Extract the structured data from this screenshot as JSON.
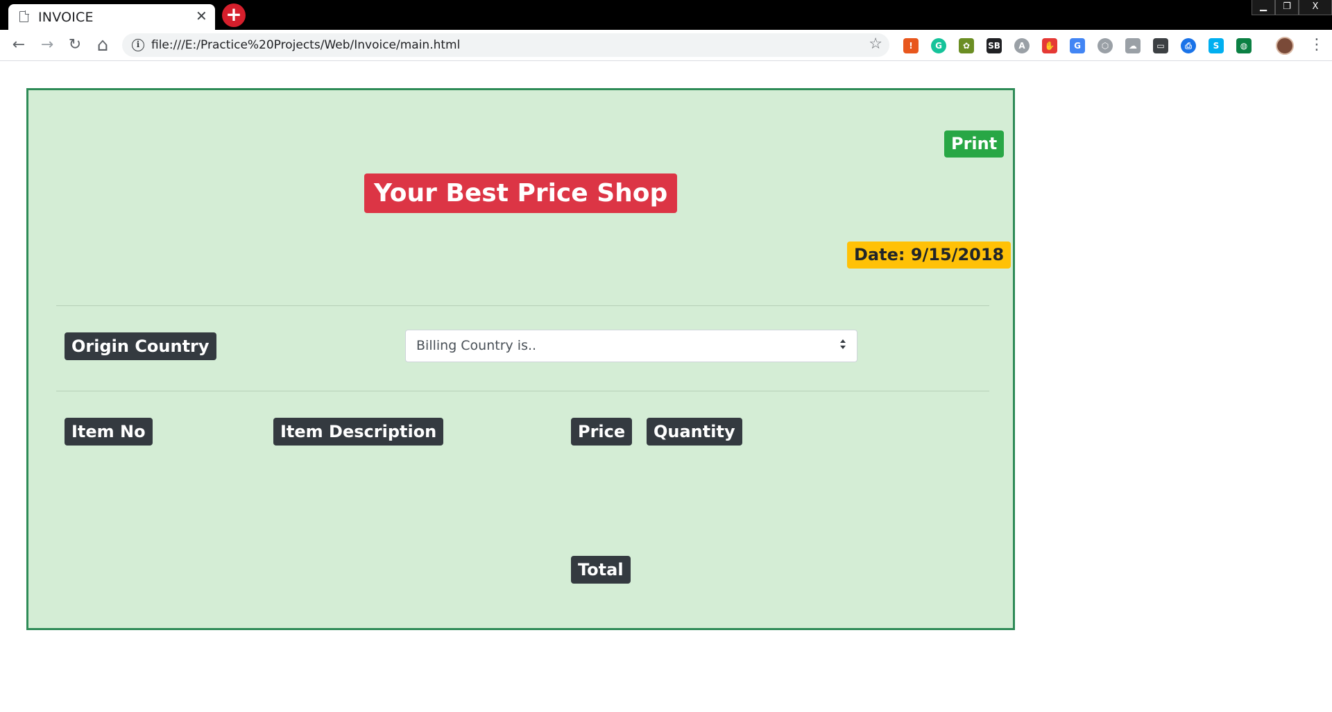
{
  "browser": {
    "tab_title": "INVOICE",
    "tab_close": "✕",
    "new_tab": "+",
    "url": "file:///E:/Practice%20Projects/Web/Invoice/main.html",
    "window_controls": {
      "minimize": "▁",
      "restore": "❐",
      "close": "X"
    },
    "nav": {
      "back": "←",
      "forward": "→",
      "reload": "↻",
      "home": "⌂",
      "info": "i",
      "bookmark": "☆",
      "menu": "⋮"
    },
    "extensions": [
      {
        "name": "alert-extension-icon",
        "glyph": "!",
        "color": "#e8571d"
      },
      {
        "name": "grammarly-extension-icon",
        "glyph": "G",
        "color": "#15c39a"
      },
      {
        "name": "plant-extension-icon",
        "glyph": "✿",
        "color": "#6b8e23"
      },
      {
        "name": "sb-extension-icon",
        "glyph": "SB",
        "color": "#202124"
      },
      {
        "name": "translate-lite-extension-icon",
        "glyph": "A",
        "color": "#9aa0a6"
      },
      {
        "name": "stop-extension-icon",
        "glyph": "✋",
        "color": "#e53935"
      },
      {
        "name": "google-translate-extension-icon",
        "glyph": "G",
        "color": "#4285f4"
      },
      {
        "name": "cube-extension-icon",
        "glyph": "⬡",
        "color": "#9aa0a6"
      },
      {
        "name": "cloud-extension-icon",
        "glyph": "☁",
        "color": "#9aa0a6"
      },
      {
        "name": "cast-extension-icon",
        "glyph": "▭",
        "color": "#3c4043"
      },
      {
        "name": "printer-extension-icon",
        "glyph": "⎙",
        "color": "#1a73e8"
      },
      {
        "name": "skype-extension-icon",
        "glyph": "S",
        "color": "#00aff0"
      },
      {
        "name": "globe-extension-icon",
        "glyph": "◍",
        "color": "#0b8043"
      }
    ]
  },
  "invoice": {
    "print_label": "Print",
    "shop_title": "Your Best Price Shop",
    "date_label": "Date: 9/15/2018",
    "origin_country_label": "Origin Country",
    "billing_country_select": "Billing Country is..",
    "columns": {
      "item_no": "Item No",
      "item_description": "Item Description",
      "price": "Price",
      "quantity": "Quantity"
    },
    "total_label": "Total"
  },
  "colors": {
    "panel_bg": "#d4edd5",
    "panel_border": "#2e8b57",
    "print_button": "#28a745",
    "title_badge": "#dc3545",
    "date_badge": "#ffc107",
    "dark_badge": "#343a40"
  }
}
